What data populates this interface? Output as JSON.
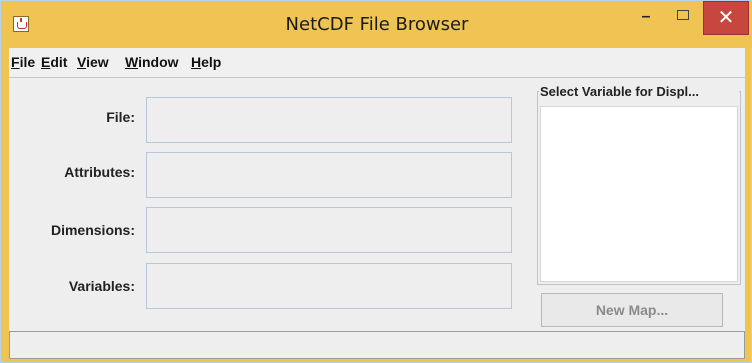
{
  "window": {
    "title": "NetCDF File Browser",
    "minimize_glyph": "–",
    "close_glyph": "✕",
    "icon": "java-icon"
  },
  "menu": {
    "items": [
      "File",
      "Edit",
      "View",
      "Window",
      "Help"
    ]
  },
  "fields": [
    {
      "label": "File:"
    },
    {
      "label": "Attributes:"
    },
    {
      "label": "Dimensions:"
    },
    {
      "label": "Variables:"
    }
  ],
  "variable_panel": {
    "title": "Select Variable for Displ..."
  },
  "buttons": {
    "new_map": "New Map..."
  },
  "colors": {
    "titlebar": "#f0c452",
    "close_button": "#c7463d"
  }
}
